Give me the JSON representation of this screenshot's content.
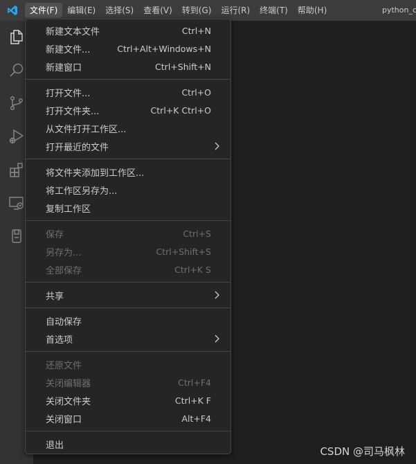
{
  "menubar": {
    "items": [
      {
        "label": "文件(F)"
      },
      {
        "label": "编辑(E)"
      },
      {
        "label": "选择(S)"
      },
      {
        "label": "查看(V)"
      },
      {
        "label": "转到(G)"
      },
      {
        "label": "运行(R)"
      },
      {
        "label": "终端(T)"
      },
      {
        "label": "帮助(H)"
      }
    ],
    "window_title": "python_c"
  },
  "activitybar": {
    "icons": [
      "explorer-icon",
      "search-icon",
      "source-control-icon",
      "run-debug-icon",
      "extensions-icon",
      "remote-explorer-icon",
      "testing-icon"
    ]
  },
  "file_menu": {
    "group1": [
      {
        "label": "新建文本文件",
        "shortcut": "Ctrl+N"
      },
      {
        "label": "新建文件...",
        "shortcut": "Ctrl+Alt+Windows+N"
      },
      {
        "label": "新建窗口",
        "shortcut": "Ctrl+Shift+N"
      }
    ],
    "group2": [
      {
        "label": "打开文件...",
        "shortcut": "Ctrl+O"
      },
      {
        "label": "打开文件夹...",
        "shortcut": "Ctrl+K Ctrl+O"
      },
      {
        "label": "从文件打开工作区..."
      },
      {
        "label": "打开最近的文件"
      }
    ],
    "group3": [
      {
        "label": "将文件夹添加到工作区..."
      },
      {
        "label": "将工作区另存为..."
      },
      {
        "label": "复制工作区"
      }
    ],
    "group4": [
      {
        "label": "保存",
        "shortcut": "Ctrl+S"
      },
      {
        "label": "另存为...",
        "shortcut": "Ctrl+Shift+S"
      },
      {
        "label": "全部保存",
        "shortcut": "Ctrl+K S"
      }
    ],
    "group5": [
      {
        "label": "共享"
      }
    ],
    "group6": [
      {
        "label": "自动保存"
      },
      {
        "label": "首选项"
      }
    ],
    "group7": [
      {
        "label": "还原文件"
      },
      {
        "label": "关闭编辑器",
        "shortcut": "Ctrl+F4"
      },
      {
        "label": "关闭文件夹",
        "shortcut": "Ctrl+K F"
      },
      {
        "label": "关闭窗口",
        "shortcut": "Alt+F4"
      }
    ],
    "group8": [
      {
        "label": "退出"
      }
    ]
  },
  "watermark": "CSDN @司马枫林",
  "colors": {
    "titlebar": "#3c3c3c",
    "activitybar": "#333333",
    "editor": "#1e1e1e",
    "menu_bg": "#252526",
    "menu_text": "#cccccc",
    "disabled_text": "#6f6f6f",
    "vscode_blue": "#23a9f2"
  }
}
